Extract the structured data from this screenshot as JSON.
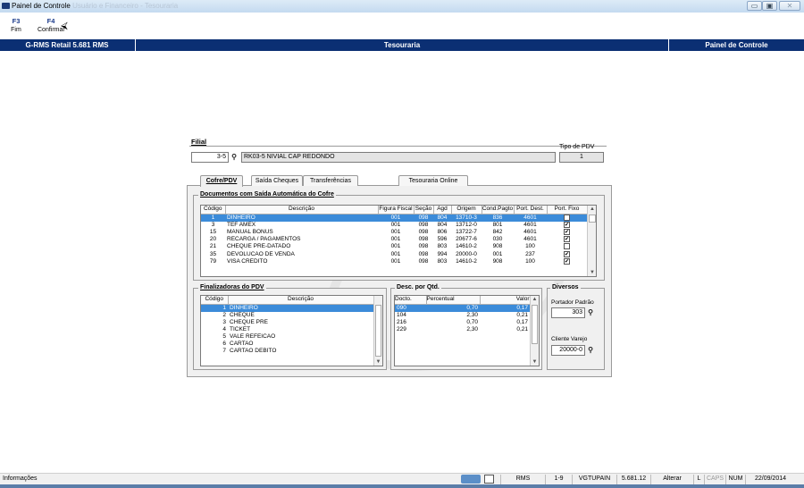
{
  "window": {
    "title": "Painel de Controle",
    "title_faded": "Usuário e Financeiro - Tesouraria",
    "min": "▭",
    "max": "▣",
    "close": "✕"
  },
  "toolbar": {
    "f3_key": "F3",
    "f3_label": "Fim",
    "f4_key": "F4",
    "f4_label": "Confirmar"
  },
  "header": {
    "left": "G-RMS Retail 5.681 RMS",
    "center": "Tesouraria",
    "right": "Painel de Controle"
  },
  "filial": {
    "label": "Filial",
    "code": "3-5",
    "name": "RK03-5 NIVIAL CAP REDONDO",
    "tipo_label": "Tipo de PDV",
    "tipo_value": "1"
  },
  "tabs": [
    "Cofre/PDV",
    "Saída Cheques",
    "Transferências",
    "Tesouraria Online"
  ],
  "docs": {
    "legend": "Documentos com Saída Automática do Cofre",
    "columns": [
      "Código",
      "Descrição",
      "Figura Fiscal",
      "Seção",
      "Agd",
      "Origem",
      "Cond.Pagto",
      "Port. Dest.",
      "Port. Fixo"
    ],
    "rows": [
      {
        "codigo": "1",
        "descricao": "DINHEIRO",
        "figura": "001",
        "secao": "098",
        "agd": "804",
        "origem": "13710-3",
        "cond": "836",
        "port_dest": "4601",
        "fixo": true
      },
      {
        "codigo": "3",
        "descricao": "TEF AMEX",
        "figura": "001",
        "secao": "098",
        "agd": "804",
        "origem": "13712-0",
        "cond": "801",
        "port_dest": "4601",
        "fixo": true
      },
      {
        "codigo": "15",
        "descricao": "MANUAL BONUS",
        "figura": "001",
        "secao": "098",
        "agd": "806",
        "origem": "13722-7",
        "cond": "842",
        "port_dest": "4601",
        "fixo": true
      },
      {
        "codigo": "20",
        "descricao": "RECARGA / PAGAMENTOS",
        "figura": "001",
        "secao": "098",
        "agd": "596",
        "origem": "20677-6",
        "cond": "030",
        "port_dest": "4601",
        "fixo": true
      },
      {
        "codigo": "21",
        "descricao": "CHEQUE PRE-DATADO",
        "figura": "001",
        "secao": "098",
        "agd": "803",
        "origem": "14610-2",
        "cond": "908",
        "port_dest": "100",
        "fixo": false
      },
      {
        "codigo": "35",
        "descricao": "DEVOLUCAO DE VENDA",
        "figura": "001",
        "secao": "098",
        "agd": "994",
        "origem": "20000-0",
        "cond": "001",
        "port_dest": "237",
        "fixo": true
      },
      {
        "codigo": "79",
        "descricao": "VISA CREDITO",
        "figura": "001",
        "secao": "098",
        "agd": "803",
        "origem": "14610-2",
        "cond": "908",
        "port_dest": "100",
        "fixo": true
      }
    ]
  },
  "finalizadoras": {
    "legend": "Finalizadoras do PDV",
    "columns": [
      "Código",
      "Descrição"
    ],
    "rows": [
      {
        "codigo": "1",
        "descricao": "DINHEIRO"
      },
      {
        "codigo": "2",
        "descricao": "CHEQUE"
      },
      {
        "codigo": "3",
        "descricao": "CHEQUE PRE"
      },
      {
        "codigo": "4",
        "descricao": "TICKET"
      },
      {
        "codigo": "5",
        "descricao": "VALE REFEICAO"
      },
      {
        "codigo": "6",
        "descricao": "CARTAO"
      },
      {
        "codigo": "7",
        "descricao": "CARTAO DEBITO"
      }
    ]
  },
  "desconto": {
    "legend": "Desc. por Qtd.",
    "columns": [
      "Docto.",
      "Percentual",
      "Valor"
    ],
    "rows": [
      {
        "docto": "090",
        "percentual": "0,70",
        "valor": "0,17"
      },
      {
        "docto": "104",
        "percentual": "2,30",
        "valor": "0,21"
      },
      {
        "docto": "216",
        "percentual": "0,70",
        "valor": "0,17"
      },
      {
        "docto": "229",
        "percentual": "2,30",
        "valor": "0,21"
      }
    ]
  },
  "diversos": {
    "legend": "Diversos",
    "portador_label": "Portador Padrão",
    "portador_value": "303",
    "cliente_label": "Cliente Varejo",
    "cliente_value": "20000-0"
  },
  "status": {
    "info": "Informações",
    "rms": "RMS",
    "range": "1-9",
    "user": "VGTUPAIN",
    "version": "5.681.12",
    "mode": "Alterar",
    "l": "L",
    "caps": "CAPS",
    "num": "NUM",
    "date": "22/09/2014"
  },
  "colors": {
    "header_bg": "#0b2f73",
    "selection": "#3b8bd9"
  }
}
